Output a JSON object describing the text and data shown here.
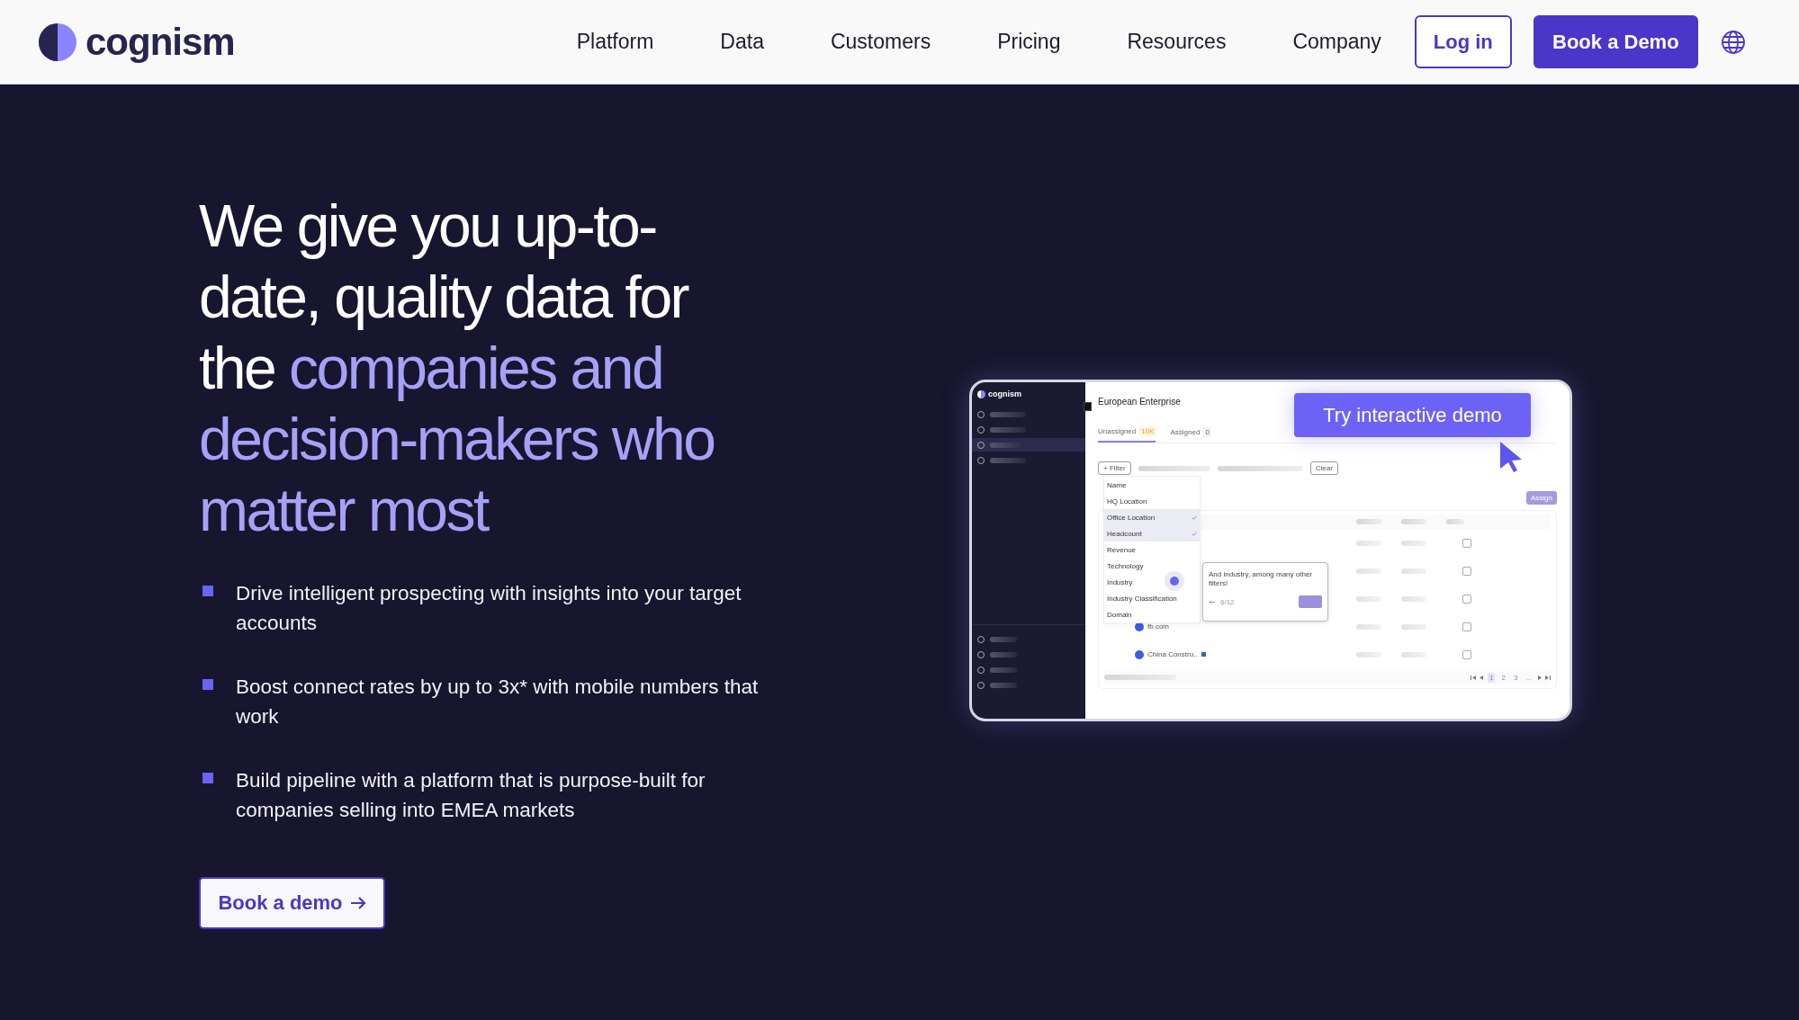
{
  "nav": {
    "logo": "cognism",
    "links": [
      "Platform",
      "Data",
      "Customers",
      "Pricing",
      "Resources",
      "Company"
    ],
    "login": "Log in",
    "cta": "Book a Demo"
  },
  "hero": {
    "headline": [
      {
        "text": "We give you up-to-date, quality data for the ",
        "highlight": false
      },
      {
        "text": "companies and decision-makers who matter most",
        "highlight": true
      }
    ],
    "bullets": [
      "Drive intelligent prospecting with insights into your target accounts",
      "Boost connect rates by up to 3x* with mobile numbers that work",
      "Build pipeline with a platform that is purpose-built for companies selling into EMEA markets"
    ],
    "cta": "Book a demo"
  },
  "demo": {
    "cta": "Try interactive demo",
    "app": {
      "logo": "cognism",
      "title": "European Enterprise",
      "tabs": [
        {
          "label": "Unassigned",
          "count": "10K",
          "selected": true
        },
        {
          "label": "Assigned",
          "count": "0",
          "selected": false
        }
      ],
      "filter_button": "+ Filter",
      "clear_button": "Clear",
      "assign_button": "Assign",
      "filter_options": [
        {
          "label": "Name",
          "checked": false
        },
        {
          "label": "HQ Location",
          "checked": false
        },
        {
          "label": "Office Location",
          "checked": true
        },
        {
          "label": "Headcount",
          "checked": true
        },
        {
          "label": "Revenue",
          "checked": false
        },
        {
          "label": "Technology",
          "checked": false
        },
        {
          "label": "Industry",
          "checked": false
        },
        {
          "label": "Industry Classification",
          "checked": false
        },
        {
          "label": "Domain",
          "checked": false
        }
      ],
      "tooltip": {
        "text": "And industry, among many other filters!",
        "step": "6/12"
      },
      "rows": [
        {
          "company": "fb.com"
        },
        {
          "company": "China Constru.."
        }
      ],
      "pages": [
        {
          "label": "1",
          "selected": true
        },
        {
          "label": "2",
          "selected": false
        },
        {
          "label": "3",
          "selected": false
        },
        {
          "label": "...",
          "selected": false
        }
      ]
    }
  }
}
